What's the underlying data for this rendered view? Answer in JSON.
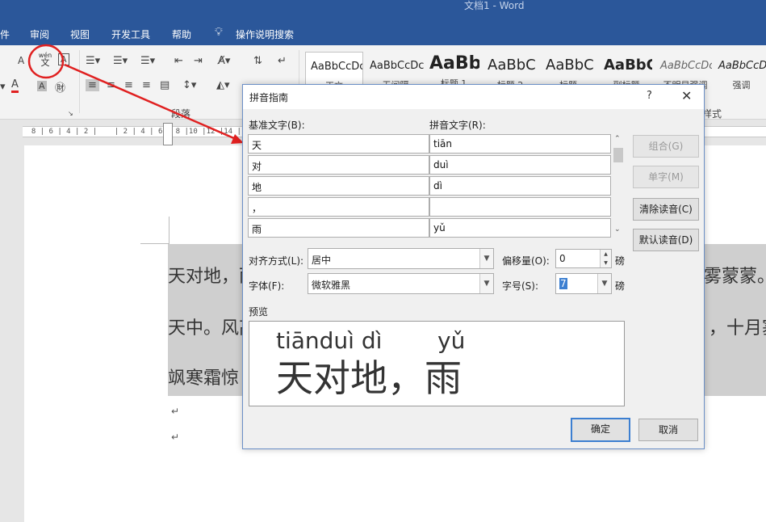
{
  "window": {
    "title": "文档1  -  Word"
  },
  "menu": {
    "items": [
      "件",
      "审阅",
      "视图",
      "开发工具",
      "帮助"
    ],
    "search": "操作说明搜索"
  },
  "ribbon": {
    "styles": [
      "AaBbCcDc",
      "AaBbCcDc",
      "AaBb",
      "AaBbC",
      "AaBbC",
      "AaBbC",
      "AaBbCcDc",
      "AaBbCcDc"
    ],
    "style_names": [
      "正文",
      "无间隔",
      "标题 1",
      "标题 2",
      "标题",
      "副标题",
      "不明显强调",
      "强调"
    ],
    "group_paragraph": "段落",
    "group_styles": "样式",
    "phonetic_icon_text": "wén\n文"
  },
  "ruler": {
    "text": "  8 | 6 | 4 | 2 |    | 2 | 4 | 6 | 8 |10 |12 |14 |16 |18 |20 |22 |24 |26 |28 |30 |32 |34 |"
  },
  "document": {
    "lines": [
      "天对地，雨",
      "天中。风高",
      "飒寒霜惊"
    ],
    "line_right": [
      "雾蒙蒙。",
      "，十月塞"
    ]
  },
  "dialog": {
    "title": "拼音指南",
    "help": "?",
    "close": "✕",
    "base_label": "基准文字(B):",
    "ruby_label": "拼音文字(R):",
    "rows": [
      {
        "base": "天",
        "ruby": "tiān"
      },
      {
        "base": "对",
        "ruby": "duì"
      },
      {
        "base": "地",
        "ruby": "dì"
      },
      {
        "base": "，",
        "ruby": ""
      },
      {
        "base": "雨",
        "ruby": "yǔ"
      }
    ],
    "buttons": {
      "group": "组合(G)",
      "mono": "单字(M)",
      "clear": "清除读音(C)",
      "default": "默认读音(D)",
      "ok": "确定",
      "cancel": "取消"
    },
    "alignment_label": "对齐方式(L):",
    "alignment_value": "居中",
    "offset_label": "偏移量(O):",
    "offset_value": "0",
    "offset_unit": "磅",
    "font_label": "字体(F):",
    "font_value": "微软雅黑",
    "size_label": "字号(S):",
    "size_value": "7",
    "size_unit": "磅",
    "preview_label": "预览",
    "preview_pinyin_1": "tiānduì dì",
    "preview_pinyin_2": "yǔ",
    "preview_text": "天对地，雨"
  },
  "colors": {
    "title_blue": "#2b579a",
    "annotation_red": "#e02020",
    "focus_blue": "#3c7fd1"
  }
}
